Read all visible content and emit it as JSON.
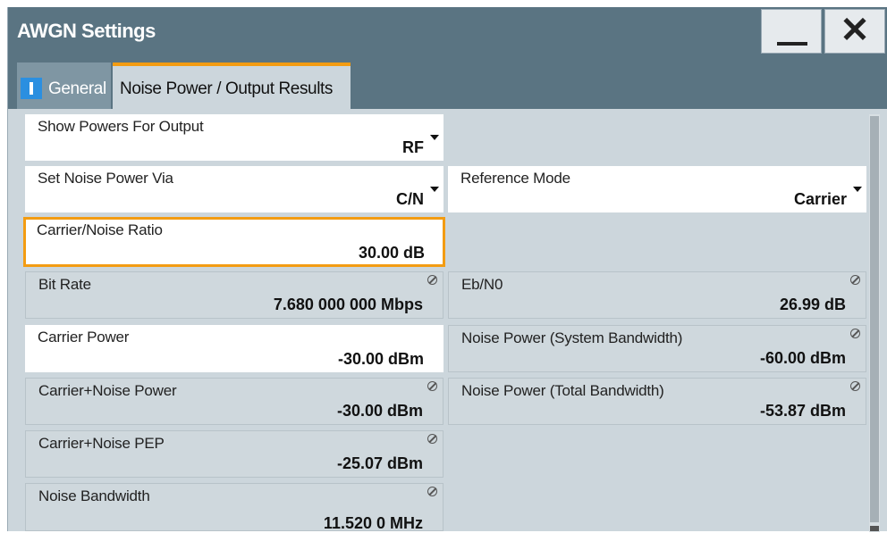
{
  "window": {
    "title": "AWGN Settings"
  },
  "controls": {
    "minimize_icon": "minimize-icon",
    "close_glyph": "✕"
  },
  "tabs": [
    {
      "label": "General",
      "icon": "info-icon"
    },
    {
      "label": "Noise Power / Output Results",
      "active": true
    }
  ],
  "fields": {
    "show_powers": {
      "label": "Show Powers For Output",
      "value": "RF"
    },
    "set_noise_power": {
      "label": "Set Noise Power Via",
      "value": "C/N"
    },
    "reference_mode": {
      "label": "Reference Mode",
      "value": "Carrier"
    },
    "cn_ratio": {
      "label": "Carrier/Noise Ratio",
      "value": "30.00 dB"
    },
    "bit_rate": {
      "label": "Bit Rate",
      "value": "7.680 000 000 Mbps"
    },
    "ebn0": {
      "label": "Eb/N0",
      "value": "26.99 dB"
    },
    "carrier_power": {
      "label": "Carrier Power",
      "value": "-30.00 dBm"
    },
    "noise_power_sys": {
      "label": "Noise Power (System Bandwidth)",
      "value": "-60.00 dBm"
    },
    "cn_power": {
      "label": "Carrier+Noise Power",
      "value": "-30.00 dBm"
    },
    "noise_power_total": {
      "label": "Noise Power (Total Bandwidth)",
      "value": "-53.87 dBm"
    },
    "cn_pep": {
      "label": "Carrier+Noise PEP",
      "value": "-25.07 dBm"
    },
    "noise_bw": {
      "label": "Noise Bandwidth",
      "value": "11.520 0 MHz"
    }
  }
}
